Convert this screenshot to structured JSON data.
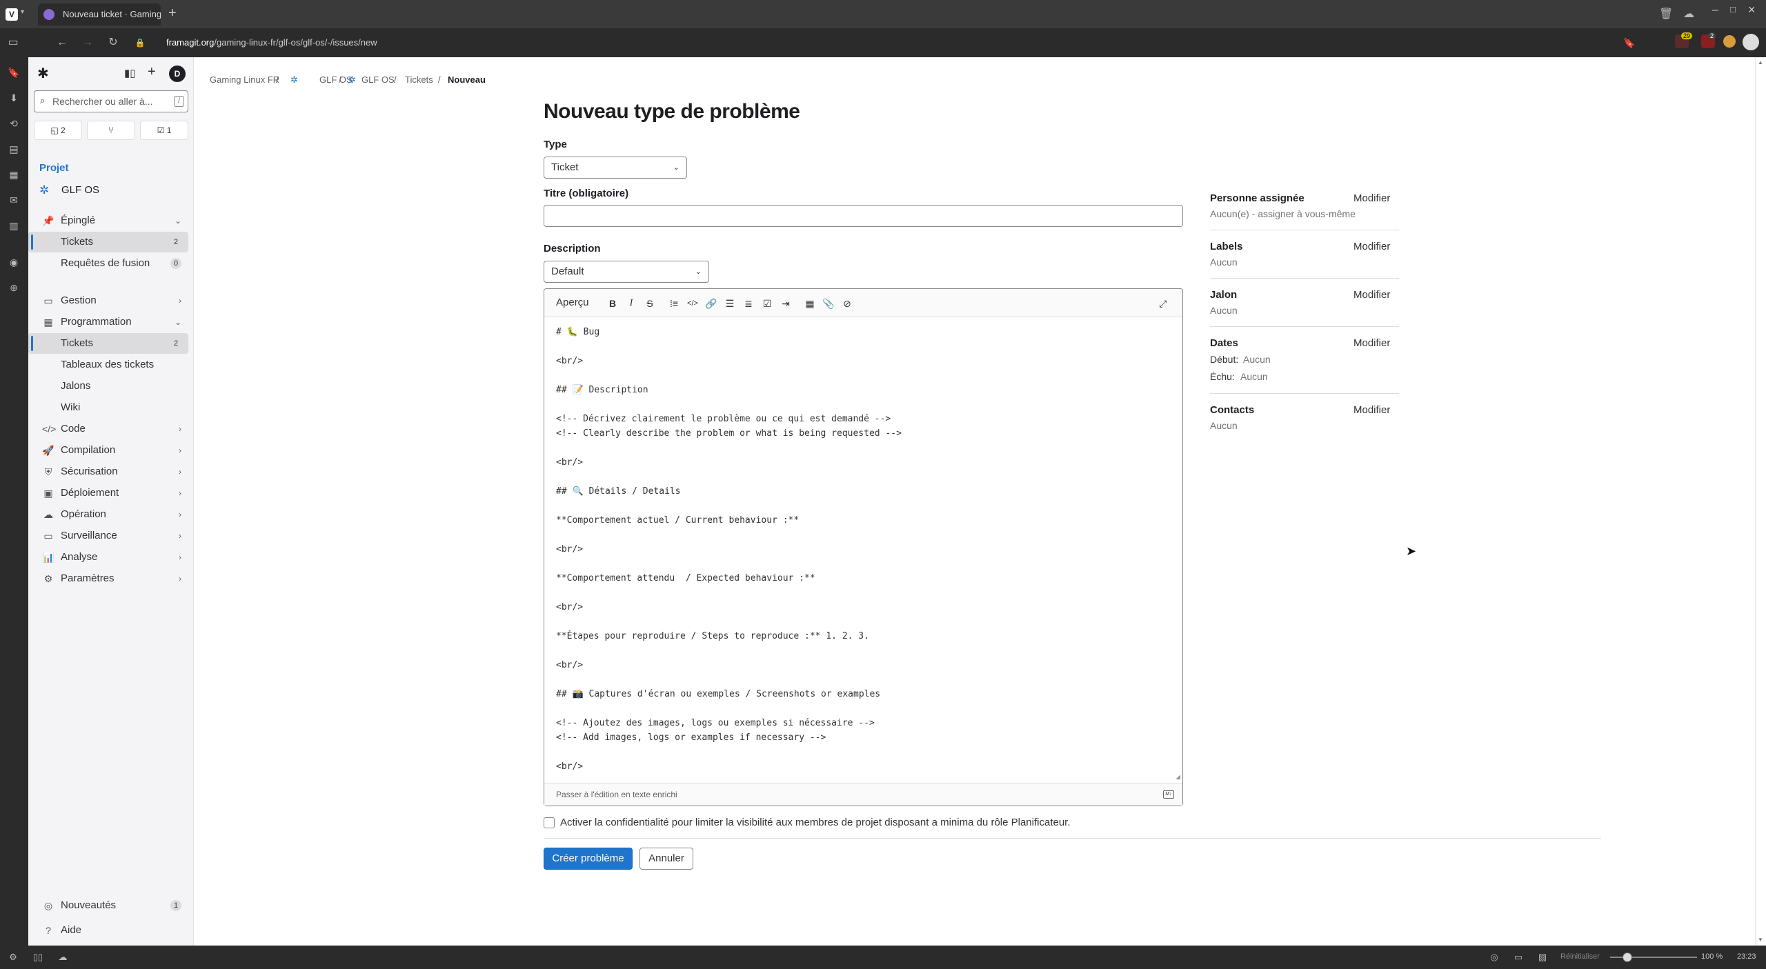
{
  "browser": {
    "tab_title": "Nouveau ticket · Gaming Li",
    "url_domain": "framagit.org",
    "url_path": "/gaming-linux-fr/glf-os/glf-os/-/issues/new",
    "badge_ext1": "29",
    "badge_ext2": "2",
    "status": {
      "reset_label": "Réinitialiser",
      "zoom": "100 %",
      "time": "23:23"
    }
  },
  "sidebar": {
    "search_placeholder": "Rechercher ou aller à...",
    "search_shortcut": "/",
    "counters": {
      "issues": "2",
      "todos": "1"
    },
    "section_label": "Projet",
    "project_name": "GLF OS",
    "pinned": {
      "label": "Épinglé",
      "items": [
        {
          "label": "Tickets",
          "count": "2"
        },
        {
          "label": "Requêtes de fusion",
          "count": "0"
        }
      ]
    },
    "nav": {
      "gestion": "Gestion",
      "programmation": "Programmation",
      "programmation_items": [
        {
          "label": "Tickets",
          "count": "2"
        },
        {
          "label": "Tableaux des tickets"
        },
        {
          "label": "Jalons"
        },
        {
          "label": "Wiki"
        }
      ],
      "code": "Code",
      "compilation": "Compilation",
      "securisation": "Sécurisation",
      "deploiement": "Déploiement",
      "operation": "Opération",
      "surveillance": "Surveillance",
      "analyse": "Analyse",
      "parametres": "Paramètres"
    },
    "bottom": {
      "whats_new": "Nouveautés",
      "whats_new_count": "1",
      "help": "Aide"
    }
  },
  "breadcrumb": [
    "Gaming Linux FR",
    "GLF OS",
    "GLF OS",
    "Tickets",
    "Nouveau"
  ],
  "form": {
    "title": "Nouveau type de problème",
    "type_label": "Type",
    "type_value": "Ticket",
    "title_label": "Titre (obligatoire)",
    "title_value": "",
    "description_label": "Description",
    "template_value": "Default",
    "preview_label": "Aperçu",
    "description_text": "# 🐛 Bug\n\n<br/>\n\n## 📝 Description\n\n<!-- Décrivez clairement le problème ou ce qui est demandé -->\n<!-- Clearly describe the problem or what is being requested -->\n\n<br/>\n\n## 🔍 Détails / Details\n\n**Comportement actuel / Current behaviour :**\n\n<br/>\n\n**Comportement attendu  / Expected behaviour :**\n\n<br/>\n\n**Étapes pour reproduire / Steps to reproduce :** 1. 2. 3.\n\n<br/>\n\n## 📸 Captures d'écran ou exemples / Screenshots or examples\n\n<!-- Ajoutez des images, logs ou exemples si nécessaire -->\n<!-- Add images, logs or examples if necessary -->\n\n<br/>",
    "rich_text_switch": "Passer à l'édition en texte enrichi",
    "confidential_label": "Activer la confidentialité pour limiter la visibilité aux membres de projet disposant a minima du rôle Planificateur.",
    "confidential_checked": false,
    "submit_label": "Créer problème",
    "cancel_label": "Annuler"
  },
  "right_sidebar": {
    "edit_label": "Modifier",
    "assignee": {
      "title": "Personne assignée",
      "value": "Aucun(e) - assigner à vous-même"
    },
    "labels": {
      "title": "Labels",
      "value": "Aucun"
    },
    "milestone": {
      "title": "Jalon",
      "value": "Aucun"
    },
    "dates": {
      "title": "Dates",
      "start_label": "Début:",
      "start_value": "Aucun",
      "due_label": "Échu:",
      "due_value": "Aucun"
    },
    "contacts": {
      "title": "Contacts",
      "value": "Aucun"
    }
  },
  "colors": {
    "accent": "#1f75cb",
    "sidebar_bg": "#f4f4f6",
    "browser_chrome": "#2b2b2b"
  }
}
